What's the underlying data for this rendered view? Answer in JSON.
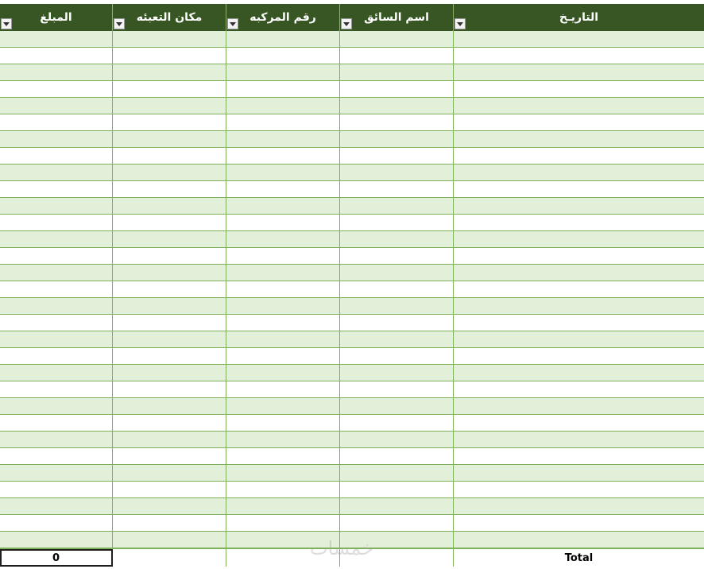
{
  "colors": {
    "header_bg": "#375623",
    "band_bg": "#e2efd9",
    "grid_line": "#7eb05a"
  },
  "table": {
    "columns": [
      {
        "key": "amount",
        "label": "المبلغ",
        "filter_icon": "dropdown-arrow-icon"
      },
      {
        "key": "fuel_place",
        "label": "مكان التعبئه",
        "filter_icon": "dropdown-arrow-icon"
      },
      {
        "key": "vehicle_no",
        "label": "رقم المركبه",
        "filter_icon": "dropdown-arrow-icon"
      },
      {
        "key": "driver_name",
        "label": "اسم السائق",
        "filter_icon": "dropdown-arrow-icon"
      },
      {
        "key": "date",
        "label": "التاريـخ",
        "filter_icon": "dropdown-arrow-icon"
      }
    ],
    "row_count": 31,
    "total": {
      "label": "Total",
      "amount": "0"
    }
  },
  "watermark": "خمسات"
}
